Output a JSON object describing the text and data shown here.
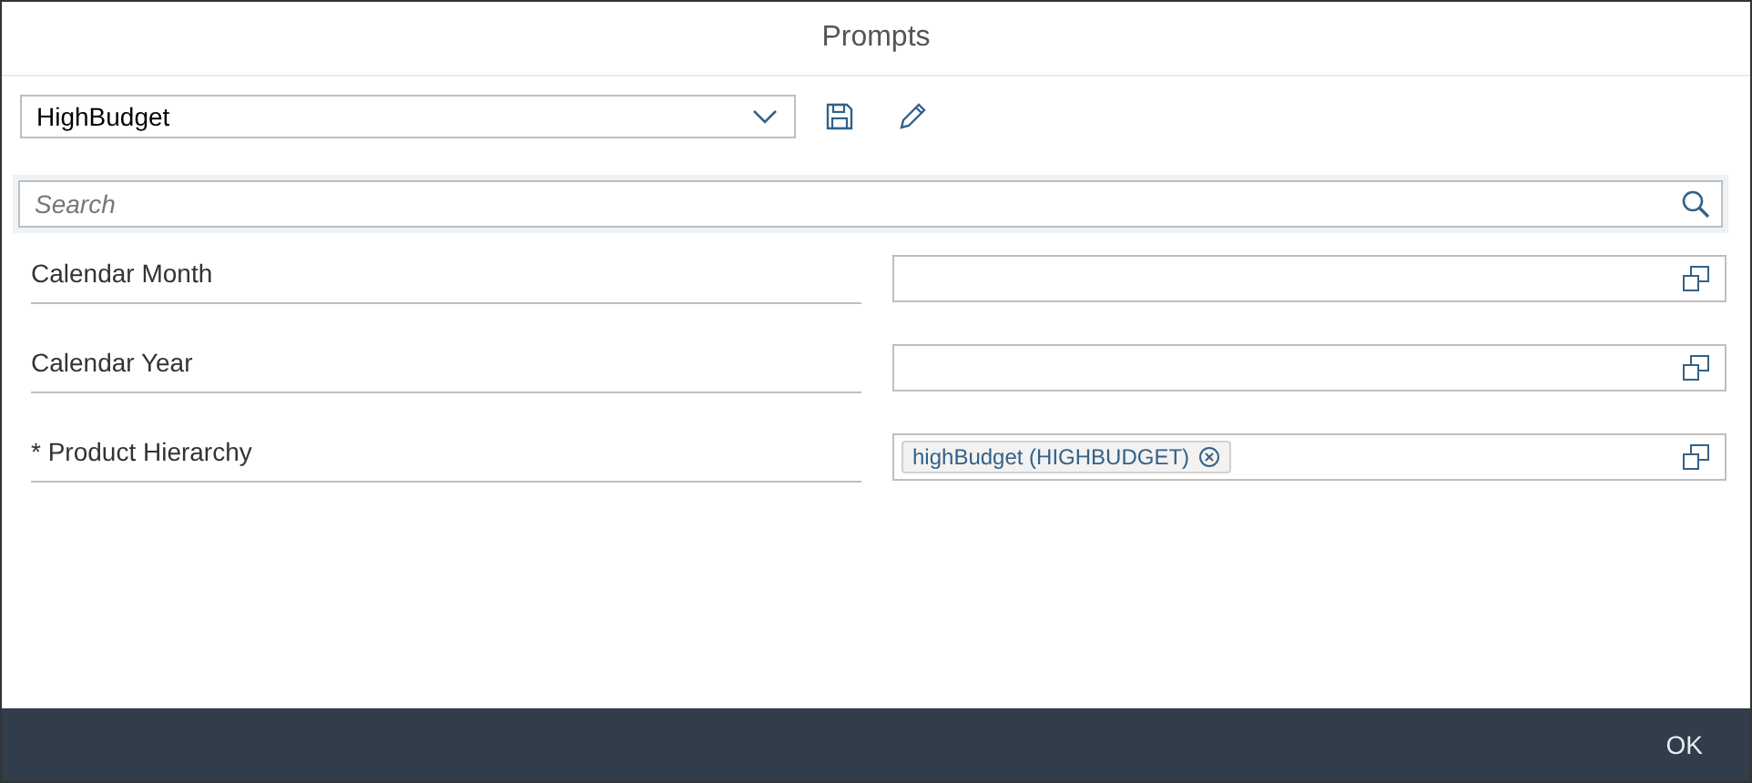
{
  "window": {
    "title": "Prompts"
  },
  "variant": {
    "value": "HighBudget"
  },
  "search": {
    "placeholder": "Search"
  },
  "prompts": [
    {
      "label": "Calendar Month"
    },
    {
      "label": "Calendar Year"
    },
    {
      "label": "* Product Hierarchy",
      "tokens": [
        "highBudget (HIGHBUDGET)"
      ]
    }
  ],
  "buttons": [
    "OK"
  ]
}
